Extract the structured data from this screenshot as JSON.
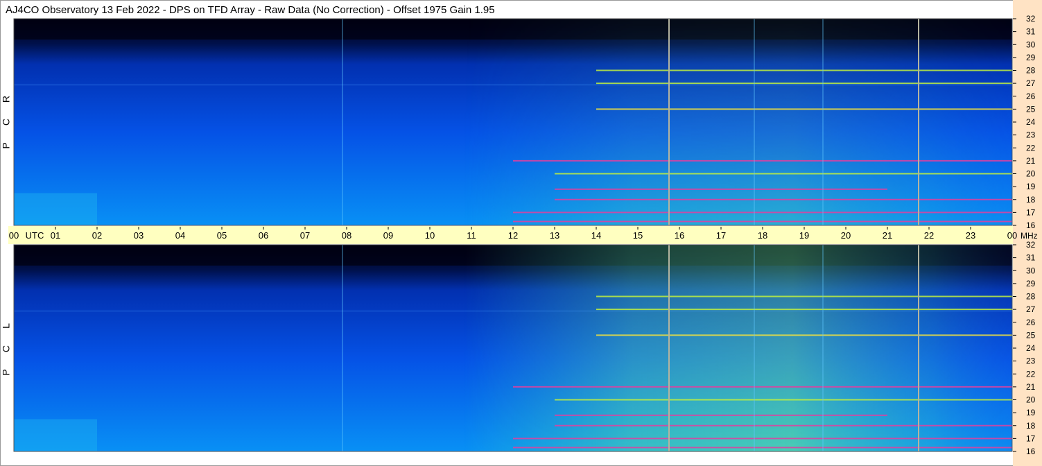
{
  "chart_data": {
    "type": "heatmap",
    "title": "AJ4CO Observatory  13 Feb 2022  -  DPS on TFD Array  -  Raw Data (No Correction)  -  Offset 1975  Gain 1.95",
    "x_tick_labels": [
      "00",
      "UTC",
      "01",
      "02",
      "03",
      "04",
      "05",
      "06",
      "07",
      "08",
      "09",
      "10",
      "11",
      "12",
      "13",
      "14",
      "15",
      "16",
      "17",
      "18",
      "19",
      "20",
      "21",
      "22",
      "23",
      "00"
    ],
    "x_range_hours": [
      0,
      24
    ],
    "y_unit": "MHz",
    "y_range_mhz": [
      16,
      32
    ],
    "y_ticks": [
      16,
      17,
      18,
      19,
      20,
      21,
      22,
      23,
      24,
      25,
      26,
      27,
      28,
      29,
      30,
      31,
      32
    ],
    "panels": [
      {
        "label_letters": [
          "R",
          "C",
          "P"
        ]
      },
      {
        "label_letters": [
          "L",
          "C",
          "P"
        ]
      }
    ],
    "vertical_markers_utc": [
      15.75,
      21.75
    ],
    "bright_bands_mhz": [
      16.3,
      17.0,
      18.0,
      18.8,
      20.0,
      21.0,
      25.0,
      27.0,
      28.0
    ],
    "faint_vertical_lines_utc": [
      7.9,
      17.8,
      19.45
    ],
    "colors": {
      "background": "#ffffff",
      "time_strip": "#ffffc0",
      "freq_strip": "#ffe3c4",
      "marker": "#b4b4a0"
    }
  }
}
